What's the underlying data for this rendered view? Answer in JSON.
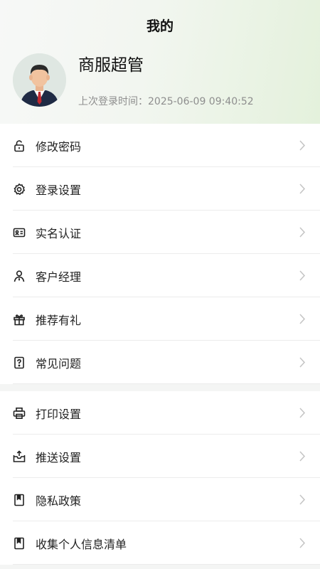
{
  "header": {
    "title": "我的",
    "user_name": "商服超管",
    "last_login": "上次登录时间：2025-06-09 09:40:52"
  },
  "menu_group_1": [
    {
      "label": "修改密码",
      "icon": "unlock-icon"
    },
    {
      "label": "登录设置",
      "icon": "gear-icon"
    },
    {
      "label": "实名认证",
      "icon": "id-card-icon"
    },
    {
      "label": "客户经理",
      "icon": "person-tie-icon"
    },
    {
      "label": "推荐有礼",
      "icon": "gift-icon"
    },
    {
      "label": "常见问题",
      "icon": "question-doc-icon"
    }
  ],
  "menu_group_2": [
    {
      "label": "打印设置",
      "icon": "printer-icon"
    },
    {
      "label": "推送设置",
      "icon": "inbox-push-icon"
    },
    {
      "label": "隐私政策",
      "icon": "bookmark-doc-icon"
    },
    {
      "label": "收集个人信息清单",
      "icon": "bookmark-doc-icon"
    }
  ]
}
